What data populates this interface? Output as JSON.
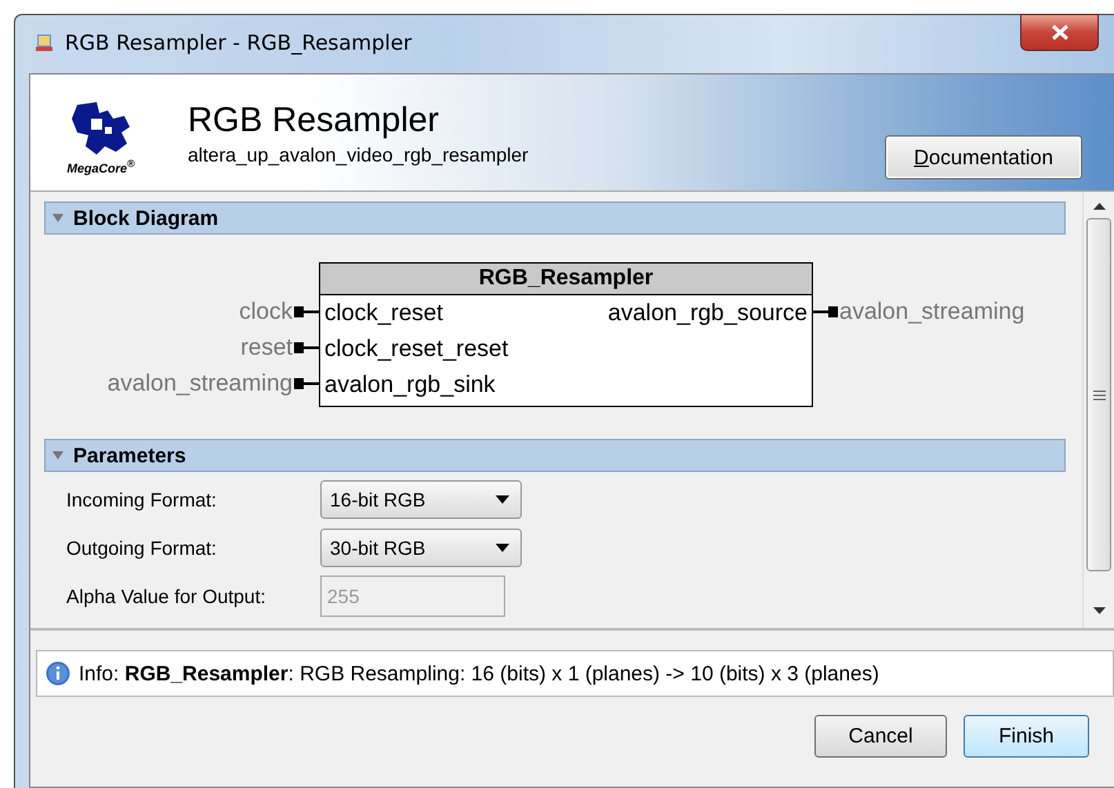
{
  "window": {
    "title": "RGB Resampler - RGB_Resampler"
  },
  "header": {
    "title": "RGB Resampler",
    "subtitle": "altera_up_avalon_video_rgb_resampler",
    "logo_text": "MegaCore$^{®}$",
    "documentation_button": "Documentation"
  },
  "block_diagram": {
    "heading": "Block Diagram",
    "expanded": true,
    "component": "RGB_Resampler",
    "left_ports": [
      {
        "external": "clock",
        "port": "clock_reset"
      },
      {
        "external": "reset",
        "port": "clock_reset_reset"
      },
      {
        "external": "avalon_streaming",
        "port": "avalon_rgb_sink"
      }
    ],
    "right_ports": [
      {
        "external": "avalon_streaming",
        "port": "avalon_rgb_source"
      }
    ]
  },
  "parameters": {
    "heading": "Parameters",
    "expanded": true,
    "fields": [
      {
        "kind": "dropdown",
        "label": "Incoming Format:",
        "value": "16-bit RGB",
        "disabled": false
      },
      {
        "kind": "dropdown",
        "label": "Outgoing Format:",
        "value": "30-bit RGB",
        "disabled": false
      },
      {
        "kind": "text",
        "label": "Alpha Value for Output:",
        "value": "255",
        "disabled": true
      }
    ]
  },
  "info": "Info: **RGB_Resampler**: RGB Resampling: 16 (bits) x 1 (planes) -> 10 (bits) x 3 (planes)",
  "buttons": [
    {
      "label": "Cancel",
      "default": false
    },
    {
      "label": "Finish",
      "default": true
    }
  ]
}
